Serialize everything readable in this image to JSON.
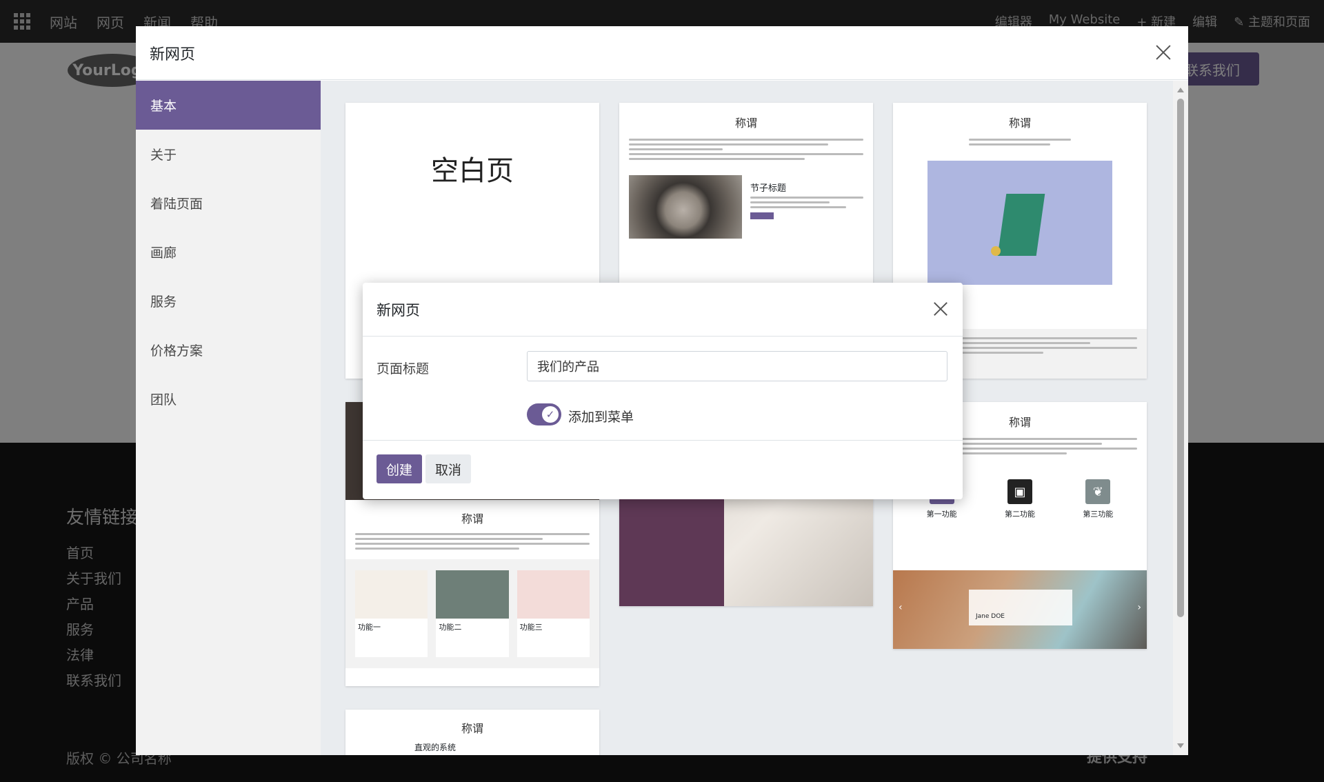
{
  "site": {
    "nav_items": [
      "网站",
      "网页",
      "新闻",
      "帮助"
    ],
    "nav_right": [
      "编辑器",
      "My Website",
      "+ 新建",
      "编辑",
      "✎ 主题和页面"
    ],
    "logo": "YourLogo",
    "contact_button": "联系我们",
    "footer_title": "友情链接",
    "footer_links": [
      "首页",
      "关于我们",
      "产品",
      "服务",
      "法律",
      "联系我们"
    ],
    "copyright": "版权 © 公司名称",
    "powered": "提供支持"
  },
  "big_modal": {
    "title": "新网页",
    "categories": [
      {
        "label": "基本",
        "active": true
      },
      {
        "label": "关于",
        "active": false
      },
      {
        "label": "着陆页面",
        "active": false
      },
      {
        "label": "画廊",
        "active": false
      },
      {
        "label": "服务",
        "active": false
      },
      {
        "label": "价格方案",
        "active": false
      },
      {
        "label": "团队",
        "active": false
      }
    ],
    "templates": {
      "blank_label": "空白页",
      "card_title": "称谓",
      "subtitle": "节子标题",
      "feature_one": "功能一",
      "feature_two": "功能二",
      "feature_three": "功能三",
      "first_feature": "第一功能",
      "second_feature": "第二功能",
      "third_feature": "第三功能",
      "system_text": "直观的系统",
      "quote_name": "Jane DOE"
    }
  },
  "small_modal": {
    "title": "新网页",
    "page_title_label": "页面标题",
    "page_title_value": "我们的产品",
    "add_to_menu_label": "添加到菜单",
    "add_to_menu_checked": true,
    "create_button": "创建",
    "cancel_button": "取消"
  },
  "colors": {
    "accent": "#6b5b95"
  }
}
